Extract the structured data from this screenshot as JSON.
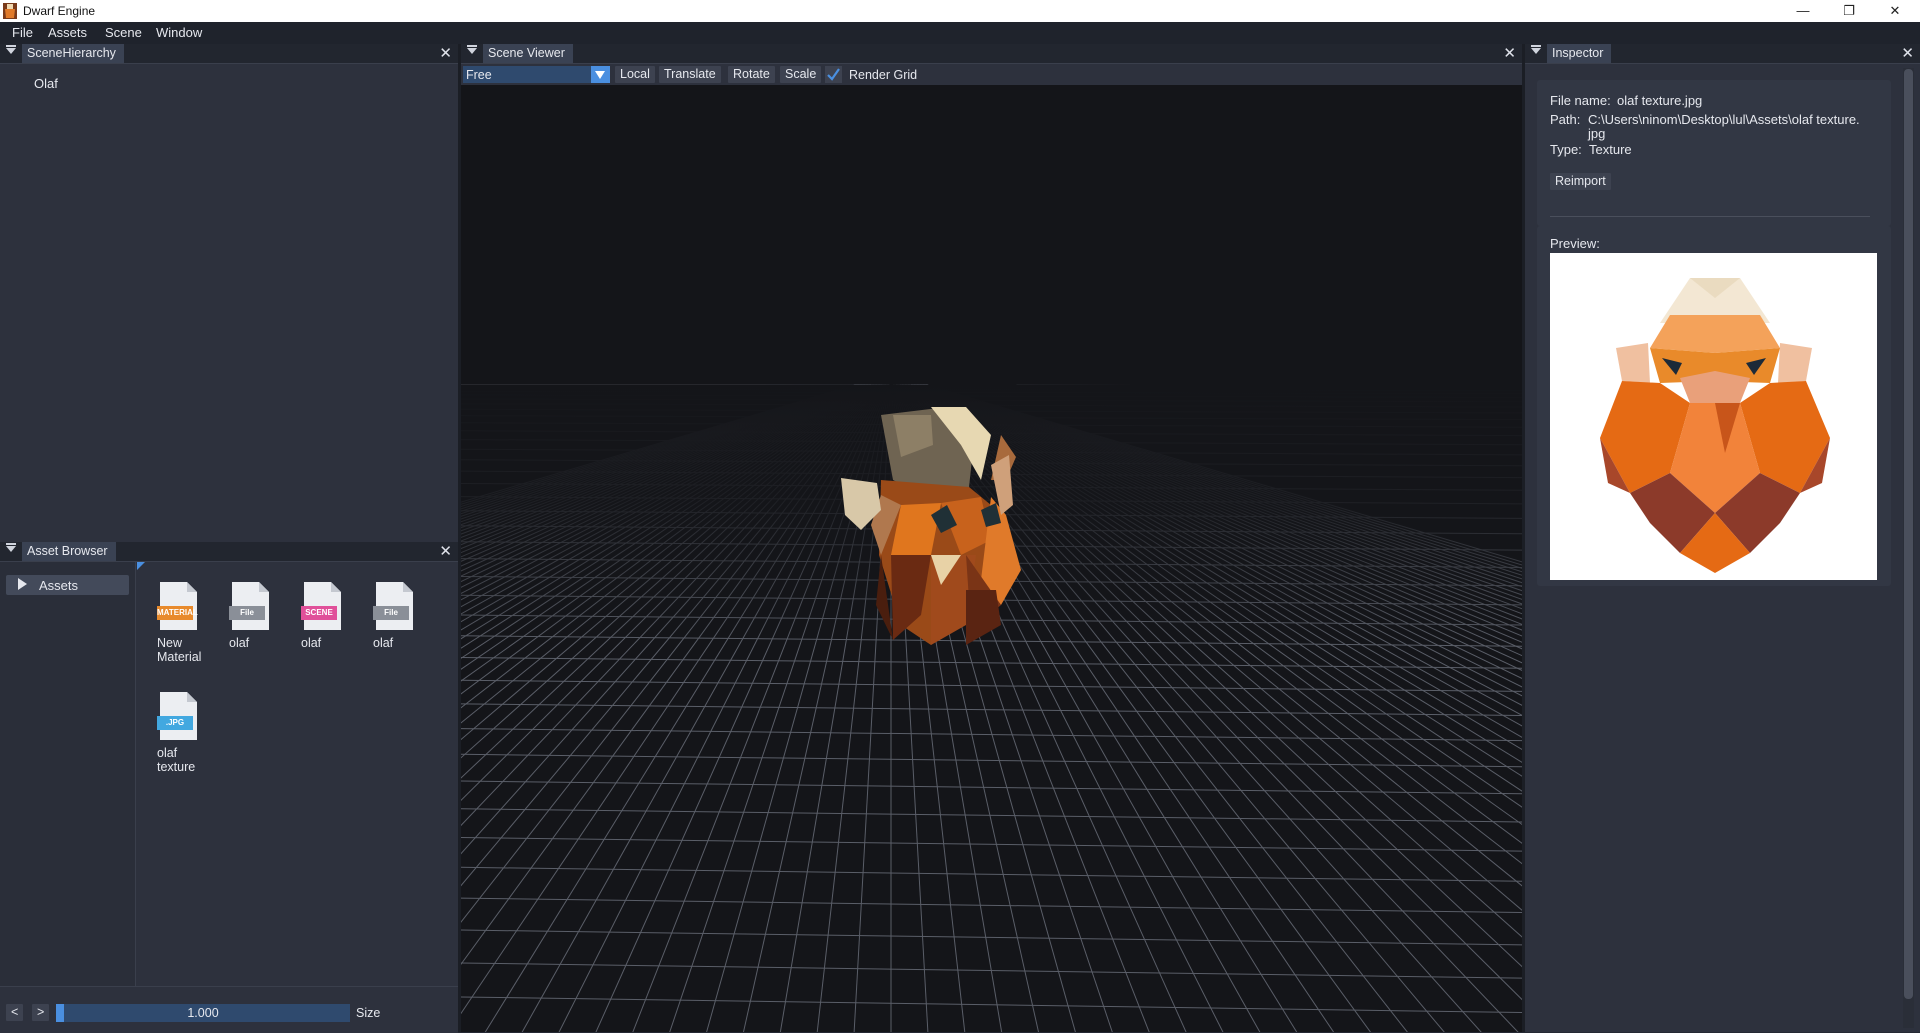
{
  "window": {
    "title": "Dwarf Engine",
    "controls": [
      "—",
      "❐",
      "✕"
    ]
  },
  "menu": [
    "File",
    "Assets",
    "Scene",
    "Window"
  ],
  "scene_hierarchy": {
    "tab": "SceneHierarchy",
    "items": [
      "Olaf"
    ]
  },
  "asset_browser": {
    "tab": "Asset Browser",
    "tree": [
      "Assets"
    ],
    "files": [
      {
        "badge": "MATERIAL",
        "label": "New\nMaterial",
        "color": "#e88a2c"
      },
      {
        "badge": "File",
        "label": "olaf",
        "color": "#8a8f98"
      },
      {
        "badge": "SCENE",
        "label": "olaf",
        "color": "#e0509a"
      },
      {
        "badge": "File",
        "label": "olaf",
        "color": "#8a8f98"
      },
      {
        "badge": ".JPG",
        "label": "olaf\ntexture",
        "color": "#42a8e0"
      }
    ],
    "nav_back": "<",
    "nav_forward": ">",
    "size_value": "1.000",
    "size_fraction": 0.02,
    "size_label": "Size"
  },
  "scene_viewer": {
    "tab": "Scene Viewer",
    "camera_mode": "Free",
    "buttons": [
      "Local",
      "Translate",
      "Rotate",
      "Scale"
    ],
    "render_grid_label": "Render Grid",
    "render_grid_checked": true
  },
  "inspector": {
    "tab": "Inspector",
    "file_name_label": "File name:",
    "file_name": "olaf texture.jpg",
    "path_label": "Path:",
    "path_line1": "C:\\Users\\ninom\\Desktop\\lul\\Assets\\olaf texture.",
    "path_line2": "jpg",
    "type_label": "Type:",
    "type": "Texture",
    "reimport_label": "Reimport",
    "preview_label": "Preview:"
  },
  "colors": {
    "accent": "#4a8fe0",
    "panel": "#2d313d",
    "viewport": "#141519"
  }
}
